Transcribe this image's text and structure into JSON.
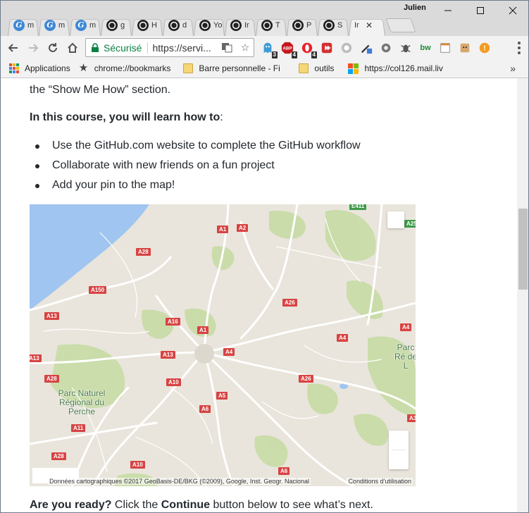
{
  "window": {
    "profile_name": "Julien"
  },
  "tabs": [
    {
      "favicon": "G",
      "label": "m",
      "favicon_type": "google"
    },
    {
      "favicon": "G",
      "label": "m",
      "favicon_type": "google"
    },
    {
      "favicon": "G",
      "label": "m",
      "favicon_type": "google"
    },
    {
      "favicon": "",
      "label": "g",
      "favicon_type": "github"
    },
    {
      "favicon": "",
      "label": "H",
      "favicon_type": "github"
    },
    {
      "favicon": "",
      "label": "d",
      "favicon_type": "github"
    },
    {
      "favicon": "",
      "label": "Yo",
      "favicon_type": "github"
    },
    {
      "favicon": "",
      "label": "Ir",
      "favicon_type": "github"
    },
    {
      "favicon": "",
      "label": "T",
      "favicon_type": "github"
    },
    {
      "favicon": "",
      "label": "P",
      "favicon_type": "github"
    },
    {
      "favicon": "",
      "label": "S",
      "favicon_type": "github"
    },
    {
      "favicon": "",
      "label": "Ir",
      "favicon_type": "none",
      "active": true
    }
  ],
  "toolbar": {
    "secure_label": "Sécurisé",
    "url": "https://servi..."
  },
  "extensions": [
    {
      "name": "ghostery-icon",
      "badge": "3"
    },
    {
      "name": "adblock-plus-icon",
      "label": "ABP",
      "badge": "4"
    },
    {
      "name": "opera-icon",
      "badge": "4"
    },
    {
      "name": "video-icon",
      "badge": ""
    },
    {
      "name": "bubble-icon",
      "badge": ""
    },
    {
      "name": "eyedropper-icon",
      "badge": ""
    },
    {
      "name": "gear-icon",
      "badge": ""
    },
    {
      "name": "bug-icon",
      "badge": ""
    },
    {
      "name": "bw-icon",
      "label": "bw",
      "badge": ""
    },
    {
      "name": "notes-icon",
      "badge": ""
    },
    {
      "name": "face-icon",
      "badge": ""
    },
    {
      "name": "alert-icon",
      "label": "!",
      "badge": ""
    }
  ],
  "bookmarks": {
    "apps": "Applications",
    "chrome_bookmarks": "chrome://bookmarks",
    "barre": "Barre personnelle - Fi",
    "outils": "outils",
    "mail": "https://col126.mail.liv",
    "more": "»"
  },
  "content": {
    "cut_line": "the “Show Me How” section.",
    "lead_bold": "In this course, you will learn how to",
    "lead_rest": ":",
    "bullets": [
      "Use the GitHub.com website to complete the GitHub workflow",
      "Collaborate with new friends on a fun project",
      "Add your pin to the map!"
    ],
    "ready_bold": "Are you ready?",
    "ready_mid": " Click the ",
    "ready_button": "Continue",
    "ready_end": " button below to see what’s next."
  },
  "map": {
    "attribution": "Données cartographiques ©2017 GeoBasis-DE/BKG (©2009), Google, Inst. Geogr. Nacional",
    "terms": "Conditions d’utilisation",
    "road_labels": [
      "A1",
      "A2",
      "A28",
      "A150",
      "A13",
      "A16",
      "A1",
      "A26",
      "A4",
      "A13",
      "A4",
      "A4",
      "A10",
      "A26",
      "A28",
      "A5",
      "A6",
      "A11",
      "A28",
      "A10",
      "A6",
      "E411",
      "A25",
      "A13",
      "A3"
    ],
    "places": [
      "Parc Naturel Régional du Perche",
      "Parc Ré de L"
    ]
  }
}
